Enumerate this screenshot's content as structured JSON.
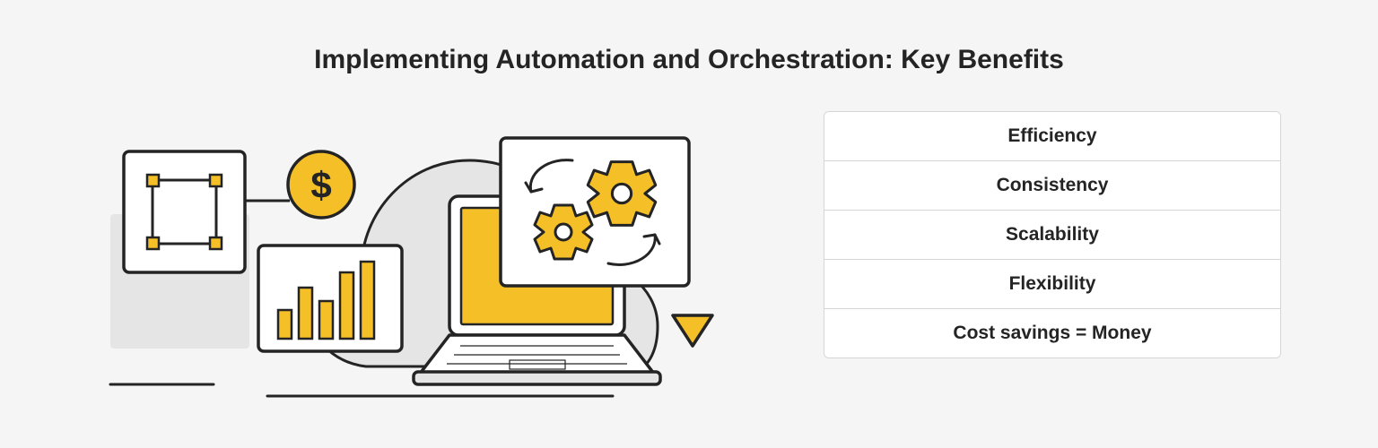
{
  "title": "Implementing Automation and Orchestration: Key Benefits",
  "benefits": {
    "items": [
      "Efficiency",
      "Consistency",
      "Scalability",
      "Flexibility",
      "Cost savings = Money"
    ]
  },
  "colors": {
    "accent": "#f5bf27",
    "stroke": "#242424",
    "light_gray": "#e5e5e5",
    "bg": "#f5f5f5"
  },
  "illustration": {
    "elements": [
      "cloud-icon",
      "bounding-box-icon",
      "dollar-coin-icon",
      "bar-chart-icon",
      "laptop-icon",
      "gears-window-icon",
      "cursor-icon"
    ]
  }
}
